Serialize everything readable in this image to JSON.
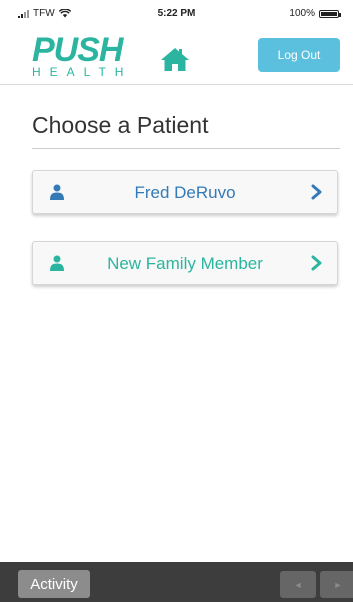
{
  "status_bar": {
    "carrier": "TFW",
    "time": "5:22 PM",
    "battery": "100%"
  },
  "header": {
    "logo_top": "PUSH",
    "logo_bottom": "HEALTH",
    "logout_label": "Log Out"
  },
  "main": {
    "title": "Choose a Patient",
    "patients": [
      {
        "label": "Fred DeRuvo",
        "color": "#337ab7"
      },
      {
        "label": "New Family Member",
        "color": "#2bb5a0"
      }
    ]
  },
  "bottom_bar": {
    "activity_label": "Activity",
    "prev_label": "◄",
    "next_label": "►"
  },
  "colors": {
    "brand": "#2bb5a0",
    "logout_bg": "#5bc0de",
    "link_blue": "#337ab7"
  }
}
